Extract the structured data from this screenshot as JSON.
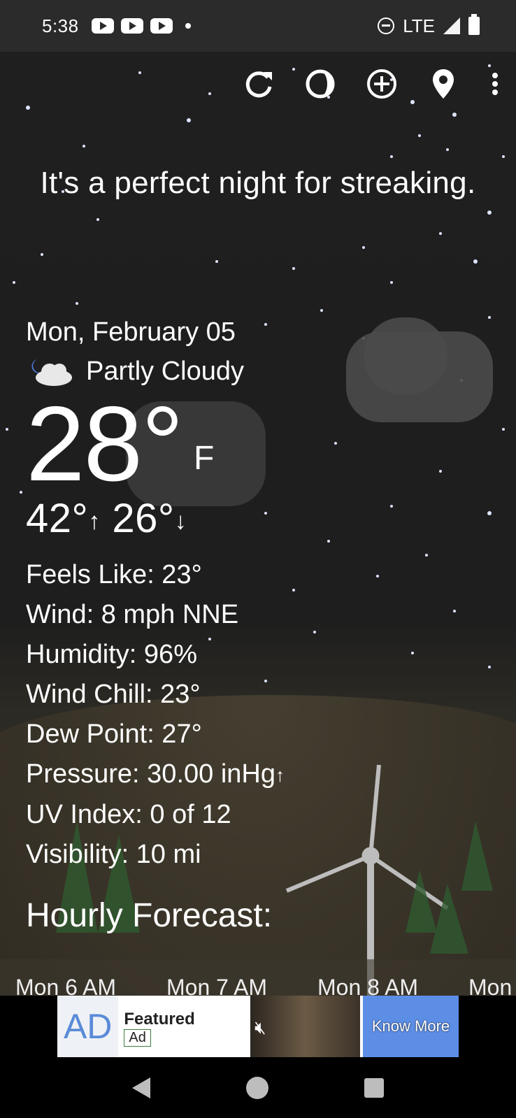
{
  "status_bar": {
    "time": "5:38",
    "network": "LTE",
    "icons": [
      "youtube-icon",
      "youtube-icon",
      "youtube-icon",
      "notification-dot",
      "do-not-disturb-icon",
      "signal-icon",
      "battery-icon"
    ]
  },
  "toolbar": {
    "icons": [
      "refresh-icon",
      "theme-icon",
      "add-location-icon",
      "location-pin-icon",
      "more-vert-icon"
    ]
  },
  "quip": "It's a perfect night for streaking.",
  "current": {
    "date": "Mon, February 05",
    "condition": "Partly Cloudy",
    "temperature": "28°",
    "unit": "F",
    "high": "42°",
    "low": "26°"
  },
  "details": {
    "feels_like": "Feels Like:  23°",
    "wind": "Wind:  8 mph NNE",
    "humidity": "Humidity:  96%",
    "wind_chill": "Wind Chill:  23°",
    "dew_point": "Dew Point:  27°",
    "pressure": "Pressure:  30.00 inHg",
    "uv_index": "UV Index:  0 of 12",
    "visibility": "Visibility:  10 mi"
  },
  "hourly": {
    "title": "Hourly Forecast:",
    "hours": [
      "Mon 6 AM",
      "Mon 7 AM",
      "Mon 8 AM",
      "Mon"
    ]
  },
  "ad": {
    "logo": "AD",
    "title": "Featured",
    "badge": "Ad",
    "cta": "Know More"
  },
  "colors": {
    "background": "#1f1f1f",
    "status_bar": "#2b2b2b",
    "ad_cta": "#5d8ee6"
  }
}
